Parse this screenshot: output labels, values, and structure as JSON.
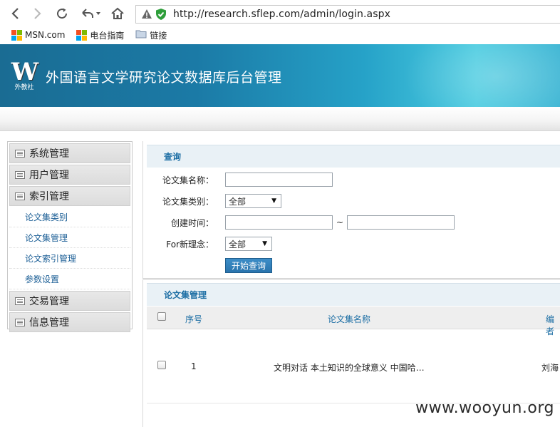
{
  "browser": {
    "url": "http://research.sflep.com/admin/login.aspx",
    "bookmarks": [
      {
        "label": "MSN.com",
        "icon": "msn-logo-icon"
      },
      {
        "label": "电台指南",
        "icon": "windows-logo-icon"
      },
      {
        "label": "链接",
        "icon": "folder-icon"
      }
    ]
  },
  "header": {
    "logo_text": "W",
    "logo_sub": "外教社",
    "title": "外国语言文学研究论文数据库后台管理",
    "colors": {
      "banner_start": "#1a6c93",
      "banner_end": "#49cbe0"
    }
  },
  "sidebar": {
    "menus": [
      {
        "label": "系统管理"
      },
      {
        "label": "用户管理"
      },
      {
        "label": "索引管理",
        "children": [
          "论文集类别",
          "论文集管理",
          "论文索引管理",
          "参数设置"
        ]
      },
      {
        "label": "交易管理"
      },
      {
        "label": "信息管理"
      }
    ]
  },
  "query": {
    "title": "查询",
    "fields": {
      "name_label": "论文集名称：",
      "name_value": "",
      "category_label": "论文集类别：",
      "category_value": "全部",
      "created_label": "创建时间：",
      "created_from": "",
      "created_to": "",
      "range_sep": "~",
      "concept_label": "For新理念：",
      "concept_value": "全部"
    },
    "search_button": "开始查询"
  },
  "list": {
    "title": "论文集管理",
    "columns": [
      "序号",
      "论文集名称",
      "编者"
    ],
    "rows": [
      {
        "index": "1",
        "name": "文明对话 本土知识的全球意义 中国哈…",
        "editor": "刘海"
      }
    ]
  },
  "watermark": "www.wooyun.org",
  "accent_color": "#1c6ea4"
}
